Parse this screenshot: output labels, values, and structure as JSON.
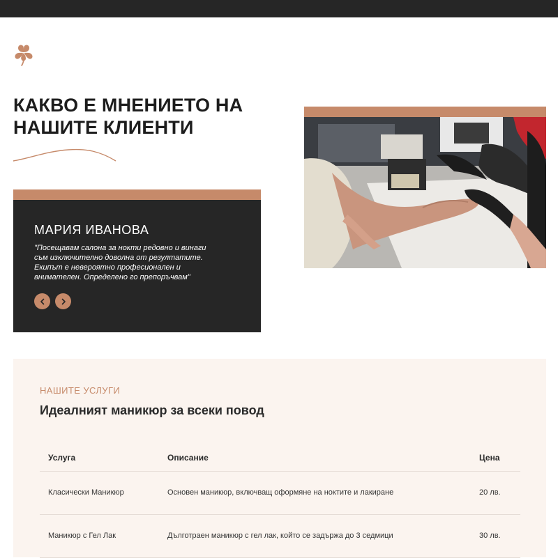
{
  "heading": {
    "line1": "КАКВО Е МНЕНИЕТО НА",
    "line2": "НАШИТЕ КЛИЕНТИ"
  },
  "testimonial": {
    "name": "МАРИЯ ИВАНОВА",
    "quote": "\"Посещавам салона за нокти редовно и винаги съм изключително доволна от резултатите. Екипът е невероятно професионален и внимателен. Определено го препоръчвам\"",
    "prev_icon": "chevron-left-icon",
    "next_icon": "chevron-right-icon"
  },
  "photo": {
    "icon": "manicure-photo"
  },
  "services": {
    "eyebrow": "НАШИТЕ УСЛУГИ",
    "title": "Идеалният маникюр за всеки повод",
    "columns": [
      "Услуга",
      "Описание",
      "Цена"
    ],
    "rows": [
      {
        "service": "Класически Маникюр",
        "description": "Основен маникюр, включващ оформяне на ноктите и лакиране",
        "price": "20 лв."
      },
      {
        "service": "Маникюр с Гел Лак",
        "description": "Дълготраен маникюр с гел лак, който се задържа до 3 седмици",
        "price": "30 лв."
      }
    ]
  },
  "colors": {
    "accent": "#c68a6a",
    "dark": "#262626",
    "services_bg": "#fbf4ef"
  }
}
